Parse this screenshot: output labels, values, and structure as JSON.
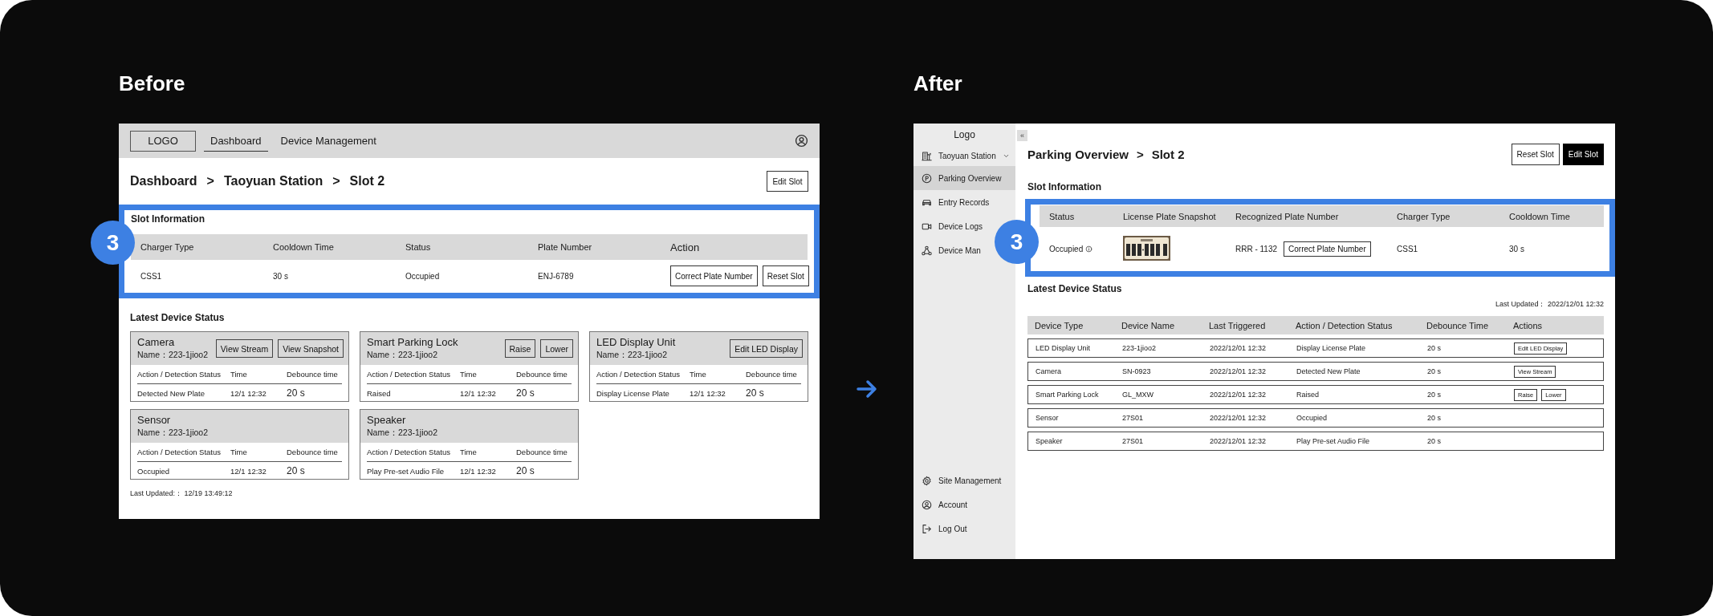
{
  "before": {
    "heading": "Before",
    "nav": {
      "logo": "LOGO",
      "tabs": [
        {
          "label": "Dashboard",
          "selected": true
        },
        {
          "label": "Device Management",
          "selected": false
        }
      ]
    },
    "breadcrumb": [
      "Dashboard",
      ">",
      "Taoyuan Station",
      ">",
      "Slot 2"
    ],
    "edit_button": "Edit Slot",
    "slot_info": {
      "badge": "3",
      "title": "Slot Information",
      "columns": [
        "Charger Type",
        "Cooldown Time",
        "Status",
        "Plate Number",
        "Action"
      ],
      "cells": [
        "CSS1",
        "30 s",
        "Occupied",
        "ENJ-6789"
      ],
      "actions": [
        "Correct Plate Number",
        "Reset Slot"
      ]
    },
    "device_status": {
      "title": "Latest Device Status",
      "cards": [
        {
          "type": "Camera",
          "name": "Name：223-1jioo2",
          "buttons": [
            "View Stream",
            "View Snapshot"
          ],
          "columns": [
            "Action / Detection Status",
            "Time",
            "Debounce time"
          ],
          "cells": [
            "Detected New Plate",
            "12/1 12:32",
            "20 s"
          ]
        },
        {
          "type": "Smart Parking Lock",
          "name": "Name：223-1jioo2",
          "buttons": [
            "Raise",
            "Lower"
          ],
          "columns": [
            "Action / Detection Status",
            "Time",
            "Debounce time"
          ],
          "cells": [
            "Raised",
            "12/1 12:32",
            "20 s"
          ]
        },
        {
          "type": "LED Display Unit",
          "name": "Name：223-1jioo2",
          "buttons": [
            "Edit LED Display"
          ],
          "columns": [
            "Action / Detection Status",
            "Time",
            "Debounce time"
          ],
          "cells": [
            "Display License Plate",
            "12/1 12:32",
            "20 s"
          ]
        },
        {
          "type": "Sensor",
          "name": "Name：223-1jioo2",
          "columns": [
            "Action / Detection Status",
            "Time",
            "Debounce time"
          ],
          "cells": [
            "Occupied",
            "12/1 12:32",
            "20 s"
          ]
        },
        {
          "type": "Speaker",
          "name": "Name：223-1jioo2",
          "columns": [
            "Action / Detection Status",
            "Time",
            "Debounce time"
          ],
          "cells": [
            "Play Pre-set Audio File",
            "12/1 12:32",
            "20 s"
          ]
        }
      ],
      "last_updated": "Last Updated:： 12/19 13:49:12"
    }
  },
  "after": {
    "heading": "After",
    "sidebar": {
      "logo": "Logo",
      "collapse": "«",
      "station": "Taoyuan Station",
      "items": [
        {
          "label": "Parking Overview",
          "selected": true
        },
        {
          "label": "Entry Records",
          "selected": false
        },
        {
          "label": "Device Logs",
          "selected": false
        },
        {
          "label": "Device Man",
          "selected": false
        }
      ],
      "bottom_items": [
        "Site Management",
        "Account",
        "Log Out"
      ]
    },
    "breadcrumb": [
      "Parking Overview",
      ">",
      "Slot 2"
    ],
    "buttons": [
      {
        "label": "Reset Slot",
        "kind": "outline"
      },
      {
        "label": "Edit Slot",
        "kind": "primary"
      }
    ],
    "slot_info": {
      "badge": "3",
      "title": "Slot Information",
      "columns": [
        "Status",
        "License Plate Snapshot",
        "Recognized Plate Number",
        "Charger Type",
        "Cooldown Time"
      ],
      "status": "Occupied",
      "snapshot": {
        "kind": "picture"
      },
      "plate": "RRR - 1132",
      "plate_action": "Correct Plate Number",
      "charger": "CSS1",
      "cooldown": "30 s"
    },
    "device_status": {
      "title": "Latest Device Status",
      "last_updated": "Last Updated： 2022/12/01 12:32",
      "columns": [
        "Device Type",
        "Device Name",
        "Last Triggered",
        "Action / Detection Status",
        "Debounce Time",
        "Actions"
      ],
      "rows": [
        {
          "cells": [
            "LED Display Unit",
            "223-1jioo2",
            "2022/12/01 12:32",
            "Display License Plate",
            "20 s"
          ],
          "actions": [
            "Edit LED Display"
          ]
        },
        {
          "cells": [
            "Camera",
            "SN-0923",
            "2022/12/01 12:32",
            "Detected New Plate",
            "20 s"
          ],
          "actions": [
            "View Stream"
          ]
        },
        {
          "cells": [
            "Smart Parking Lock",
            "GL_MXW",
            "2022/12/01 12:32",
            "Raised",
            "20 s"
          ],
          "actions": [
            "Raise",
            "Lower"
          ]
        },
        {
          "cells": [
            "Sensor",
            "27S01",
            "2022/12/01 12:32",
            "Occupied",
            "20 s"
          ]
        },
        {
          "cells": [
            "Speaker",
            "27S01",
            "2022/12/01 12:32",
            "Play Pre-set Audio File",
            "20 s"
          ]
        }
      ]
    }
  }
}
